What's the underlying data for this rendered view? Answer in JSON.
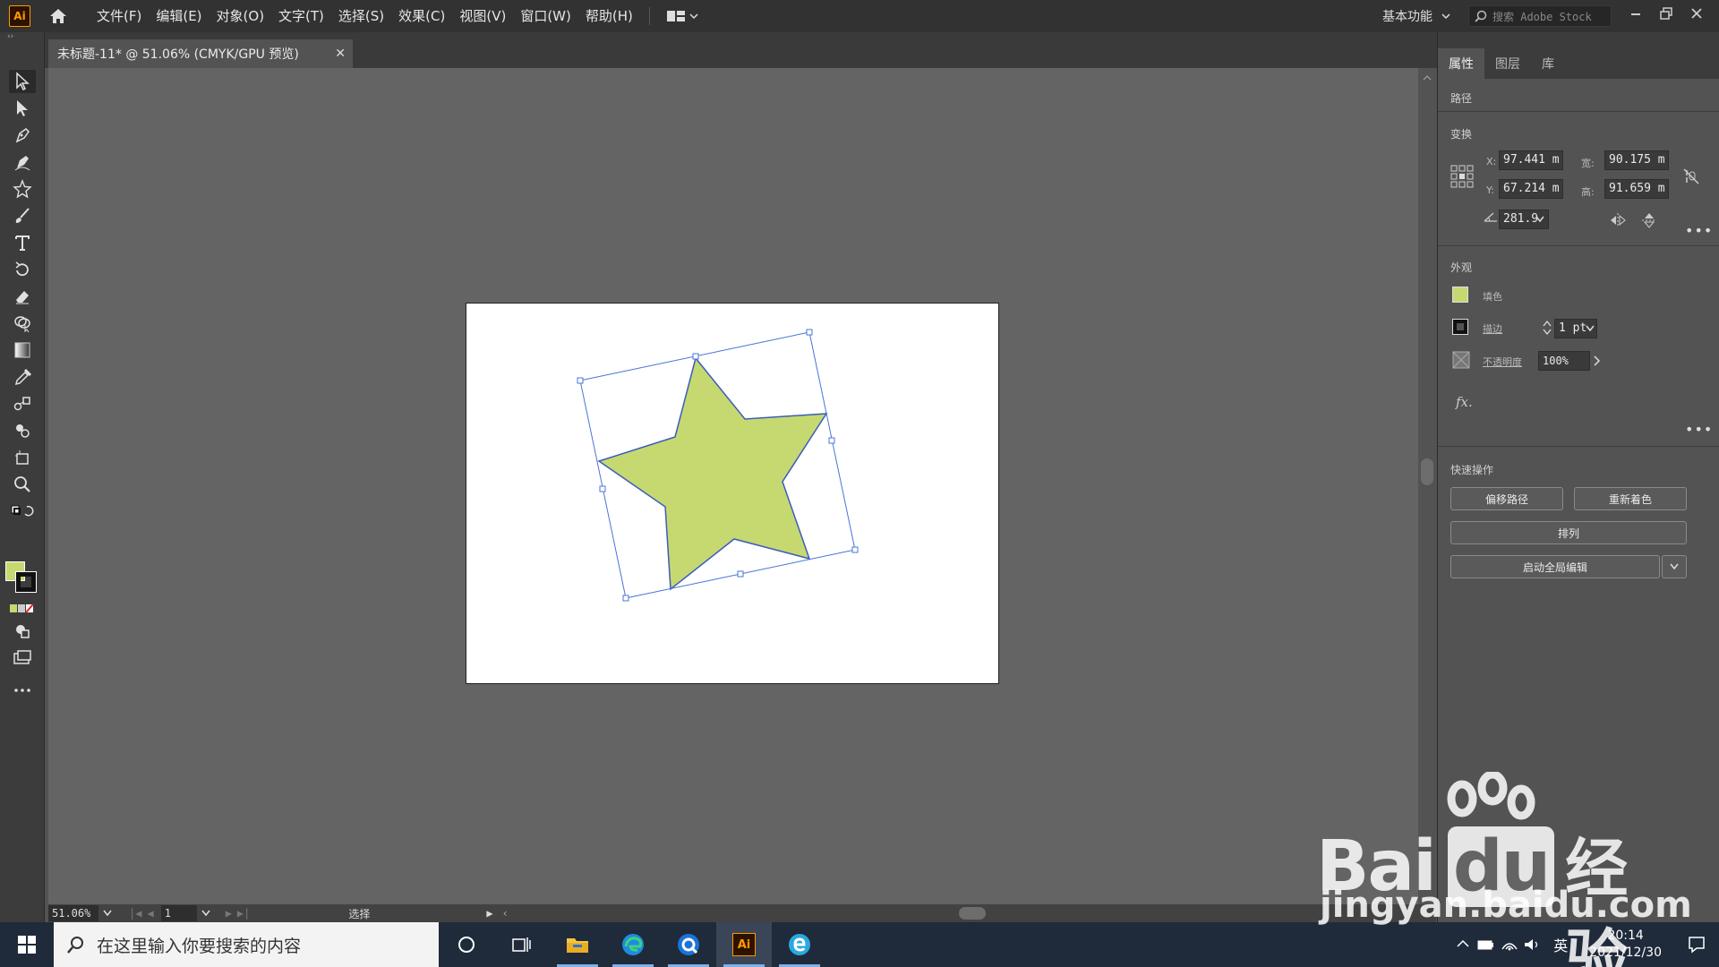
{
  "app": {
    "logo": "Ai",
    "menu": [
      "文件(F)",
      "编辑(E)",
      "对象(O)",
      "文字(T)",
      "选择(S)",
      "效果(C)",
      "视图(V)",
      "窗口(W)",
      "帮助(H)"
    ],
    "workspace": "基本功能",
    "stock_search_placeholder": "搜索 Adobe Stock"
  },
  "document": {
    "tab_title": "未标题-11* @ 51.06% (CMYK/GPU 预览)",
    "fill_color": "#c5d970",
    "stroke_color": "#3c5cbc",
    "selection_color": "#4a74d6"
  },
  "statusbar": {
    "zoom": "51.06%",
    "artboard": "1",
    "tool_label": "选择"
  },
  "panel": {
    "tabs": [
      "属性",
      "图层",
      "库"
    ],
    "object_type": "路径",
    "transform": {
      "title": "变换",
      "x_label": "X:",
      "x": "97.441 m",
      "y_label": "Y:",
      "y": "67.214 m",
      "w_label": "宽:",
      "w": "90.175 m",
      "h_label": "高:",
      "h": "91.659 m",
      "angle": "281.9"
    },
    "appearance": {
      "title": "外观",
      "fill_label": "填色",
      "stroke_label": "描边",
      "stroke_weight": "1 pt",
      "opacity_label": "不透明度",
      "opacity": "100%",
      "fx": "fx."
    },
    "quick_actions": {
      "title": "快速操作",
      "offset_path": "偏移路径",
      "recolor": "重新着色",
      "arrange": "排列",
      "global_edit": "启动全局编辑"
    }
  },
  "taskbar": {
    "search_placeholder": "在这里输入你要搜索的内容",
    "ime": "英",
    "time": "20:14",
    "date": "2021/12/30"
  },
  "watermark": {
    "brand": "Bai",
    "brand2": "du",
    "cn": "经验",
    "url": "jingyan.baidu.com"
  }
}
